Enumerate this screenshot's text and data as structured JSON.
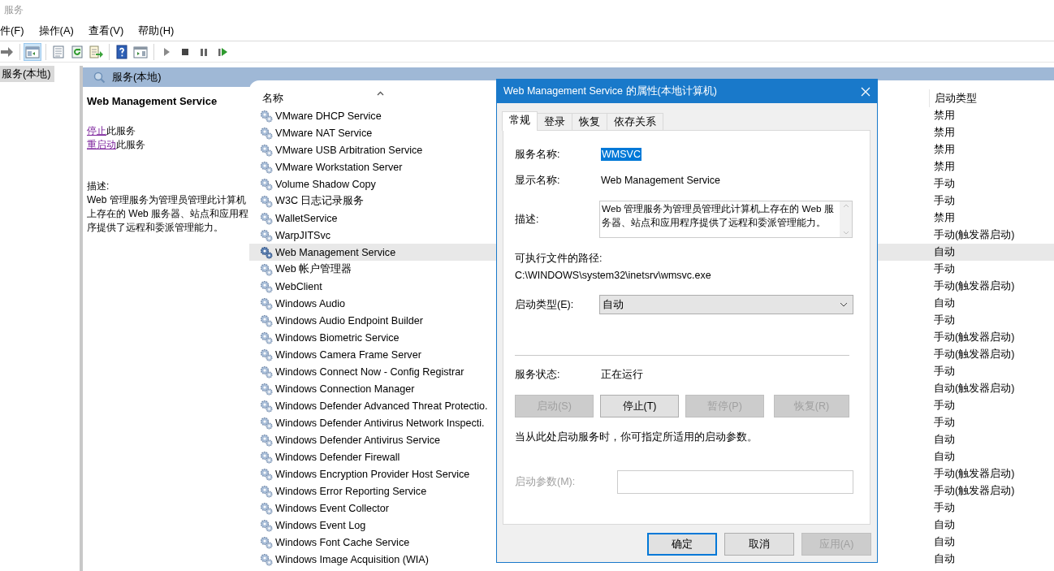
{
  "window": {
    "title": "服务"
  },
  "menu": [
    {
      "label": "件(F)"
    },
    {
      "label": "操作(A)"
    },
    {
      "label": "查看(V)"
    },
    {
      "label": "帮助(H)"
    }
  ],
  "toolbar": [
    {
      "kind": "forward",
      "pressed": false
    },
    {
      "kind": "sep"
    },
    {
      "kind": "pane",
      "pressed": true
    },
    {
      "kind": "sep"
    },
    {
      "kind": "properties",
      "pressed": false
    },
    {
      "kind": "refresh",
      "pressed": false
    },
    {
      "kind": "export",
      "pressed": false
    },
    {
      "kind": "sep"
    },
    {
      "kind": "help",
      "pressed": false
    },
    {
      "kind": "console",
      "pressed": false
    },
    {
      "kind": "sep"
    },
    {
      "kind": "play",
      "pressed": false
    },
    {
      "kind": "stop",
      "pressed": false
    },
    {
      "kind": "pause",
      "pressed": false
    },
    {
      "kind": "resume",
      "pressed": false
    }
  ],
  "tree": [
    {
      "label": "服务(本地)",
      "selected": true
    }
  ],
  "pane": {
    "title": "服务(本地)",
    "detail": {
      "name": "Web Management Service",
      "actions": [
        {
          "link": "停止",
          "text": "此服务"
        },
        {
          "link": "重启动",
          "text": "此服务"
        }
      ],
      "description_label": "描述:",
      "description": "Web 管理服务为管理员管理此计算机上存在的 Web 服务器、站点和应用程序提供了远程和委派管理能力。"
    },
    "columns": [
      {
        "label": "名称",
        "sorted": true
      },
      {
        "label": "启动类型"
      }
    ],
    "rows": [
      {
        "name": "VMware DHCP Service",
        "startup": "禁用",
        "selected": false
      },
      {
        "name": "VMware NAT Service",
        "startup": "禁用",
        "selected": false
      },
      {
        "name": "VMware USB Arbitration Service",
        "startup": "禁用",
        "selected": false
      },
      {
        "name": "VMware Workstation Server",
        "startup": "禁用",
        "selected": false
      },
      {
        "name": "Volume Shadow Copy",
        "startup": "手动",
        "selected": false
      },
      {
        "name": "W3C 日志记录服务",
        "startup": "手动",
        "selected": false
      },
      {
        "name": "WalletService",
        "startup": "禁用",
        "selected": false
      },
      {
        "name": "WarpJITSvc",
        "startup": "手动(触发器启动)",
        "selected": false
      },
      {
        "name": "Web Management Service",
        "startup": "自动",
        "selected": true
      },
      {
        "name": "Web 帐户管理器",
        "startup": "手动",
        "selected": false
      },
      {
        "name": "WebClient",
        "startup": "手动(触发器启动)",
        "selected": false
      },
      {
        "name": "Windows Audio",
        "startup": "自动",
        "selected": false
      },
      {
        "name": "Windows Audio Endpoint Builder",
        "startup": "手动",
        "selected": false
      },
      {
        "name": "Windows Biometric Service",
        "startup": "手动(触发器启动)",
        "selected": false
      },
      {
        "name": "Windows Camera Frame Server",
        "startup": "手动(触发器启动)",
        "selected": false
      },
      {
        "name": "Windows Connect Now - Config Registrar",
        "startup": "手动",
        "selected": false
      },
      {
        "name": "Windows Connection Manager",
        "startup": "自动(触发器启动)",
        "selected": false
      },
      {
        "name": "Windows Defender Advanced Threat Protectio.",
        "startup": "手动",
        "selected": false
      },
      {
        "name": "Windows Defender Antivirus Network Inspecti.",
        "startup": "手动",
        "selected": false
      },
      {
        "name": "Windows Defender Antivirus Service",
        "startup": "自动",
        "selected": false
      },
      {
        "name": "Windows Defender Firewall",
        "startup": "自动",
        "selected": false
      },
      {
        "name": "Windows Encryption Provider Host Service",
        "startup": "手动(触发器启动)",
        "selected": false
      },
      {
        "name": "Windows Error Reporting Service",
        "startup": "手动(触发器启动)",
        "selected": false
      },
      {
        "name": "Windows Event Collector",
        "startup": "手动",
        "selected": false
      },
      {
        "name": "Windows Event Log",
        "startup": "自动",
        "selected": false
      },
      {
        "name": "Windows Font Cache Service",
        "startup": "自动",
        "selected": false
      },
      {
        "name": "Windows Image Acquisition (WIA)",
        "startup": "自动",
        "selected": false
      }
    ]
  },
  "dialog": {
    "title": "Web Management Service 的属性(本地计算机)",
    "tabs": [
      {
        "label": "常规",
        "selected": true
      },
      {
        "label": "登录",
        "selected": false
      },
      {
        "label": "恢复",
        "selected": false
      },
      {
        "label": "依存关系",
        "selected": false
      }
    ],
    "service_name": {
      "label": "服务名称:",
      "value": "WMSVC"
    },
    "display_name": {
      "label": "显示名称:",
      "value": "Web Management Service"
    },
    "description": {
      "label": "描述:",
      "value": "Web 管理服务为管理员管理此计算机上存在的 Web 服务器、站点和应用程序提供了远程和委派管理能力。"
    },
    "path": {
      "label": "可执行文件的路径:",
      "value": "C:\\WINDOWS\\system32\\inetsrv\\wmsvc.exe"
    },
    "startup_type": {
      "label": "启动类型(E):",
      "value": "自动"
    },
    "status": {
      "label": "服务状态:",
      "value": "正在运行"
    },
    "service_buttons": [
      {
        "label": "启动(S)",
        "disabled": true
      },
      {
        "label": "停止(T)",
        "disabled": false
      },
      {
        "label": "暂停(P)",
        "disabled": true
      },
      {
        "label": "恢复(R)",
        "disabled": true
      }
    ],
    "note": "当从此处启动服务时，你可指定所适用的启动参数。",
    "start_params": {
      "label": "启动参数(M):",
      "disabled": true
    },
    "buttons": [
      {
        "label": "确定",
        "default": true,
        "disabled": false
      },
      {
        "label": "取消",
        "default": false,
        "disabled": false
      },
      {
        "label": "应用(A)",
        "default": false,
        "disabled": true
      }
    ]
  }
}
